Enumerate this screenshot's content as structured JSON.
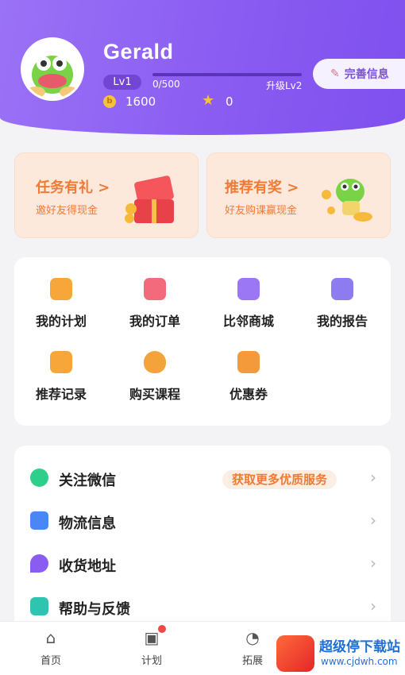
{
  "profile": {
    "username": "Gerald",
    "level": "Lv1",
    "progress_text": "0/500",
    "progress_fraction": 0,
    "upgrade_text": "升级Lv2",
    "coins": "1600",
    "stars": "0",
    "complete_info": "完善信息"
  },
  "promos": [
    {
      "title": "任务有礼 >",
      "sub": "邀好友得现金"
    },
    {
      "title": "推荐有奖 >",
      "sub": "好友购课赢现金"
    }
  ],
  "grid": [
    {
      "label": "我的计划",
      "icon": "plan-icon",
      "color": "#f7a63a"
    },
    {
      "label": "我的订单",
      "icon": "order-icon",
      "color": "#f26a7c"
    },
    {
      "label": "比邻商城",
      "icon": "shop-icon",
      "color": "#9b77f5"
    },
    {
      "label": "我的报告",
      "icon": "report-icon",
      "color": "#8d7cf0"
    },
    {
      "label": "推荐记录",
      "icon": "recommend-icon",
      "color": "#f7a63a"
    },
    {
      "label": "购买课程",
      "icon": "course-bag-icon",
      "color": "#f4a33a"
    },
    {
      "label": "优惠券",
      "icon": "coupon-icon",
      "color": "#f59a3a"
    }
  ],
  "list": [
    {
      "label": "关注微信",
      "icon": "wechat-icon",
      "color": "#2ecf8a",
      "tag": "获取更多优质服务"
    },
    {
      "label": "物流信息",
      "icon": "truck-icon",
      "color": "#4a86f5"
    },
    {
      "label": "收货地址",
      "icon": "location-icon",
      "color": "#8a5cf2"
    },
    {
      "label": "帮助与反馈",
      "icon": "help-icon",
      "color": "#2ec4b0"
    }
  ],
  "tabs": [
    {
      "label": "首页",
      "icon": "home-icon"
    },
    {
      "label": "计划",
      "icon": "plan-tab-icon"
    },
    {
      "label": "拓展",
      "icon": "explore-icon"
    }
  ],
  "watermark": {
    "title": "超级停下载站",
    "url": "www.cjdwh.com"
  }
}
